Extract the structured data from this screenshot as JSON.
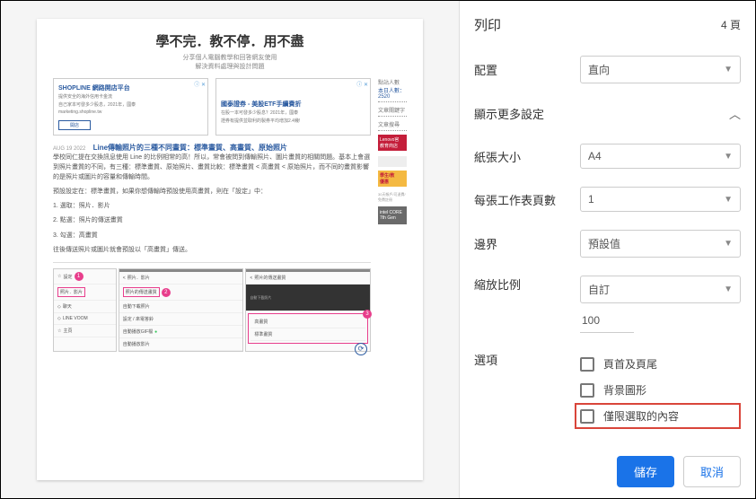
{
  "print": {
    "title": "列印",
    "pages": "4 頁",
    "layout_label": "配置",
    "layout_value": "直向",
    "more_settings": "顯示更多設定",
    "paper_label": "紙張大小",
    "paper_value": "A4",
    "sheets_label": "每張工作表頁數",
    "sheets_value": "1",
    "margin_label": "邊界",
    "margin_value": "預設值",
    "scale_label": "縮放比例",
    "scale_value": "自訂",
    "scale_number": "100",
    "options_label": "選項",
    "opt_header_footer": "頁首及頁尾",
    "opt_backgrounds": "背景圖形",
    "opt_selection": "僅限選取的內容",
    "save": "儲存",
    "cancel": "取消"
  },
  "preview": {
    "title": "學不完．教不停．用不盡",
    "subtitle1": "分享個人電腦教學和回答網友使用",
    "subtitle2": "解決資料處理與設計問題",
    "ad1_title": "SHOPLINE 網路開店平台",
    "ad1_line1": "提供安全的海外信用卡金流",
    "ad1_line2": "自己家本可發多少股息，2021年，國泰",
    "ad1_btn": "開店",
    "ad2_title": "國泰證券 - 美股ETF手續費折",
    "ad2_line": "在股一本可發多少股息？2021年，國泰",
    "ad2_line2": "證券有提供並取利的製券平均增加2.4幾!",
    "sb_visitors": "點站人數",
    "sb_today": "本日人數：2520",
    "sb_articles": "文章關鍵字",
    "sb_search": "文章搜尋",
    "date": "AUG 19 2022",
    "article_title": "Line傳輸照片的三種不同畫質：標準畫質、高畫質、原始照片",
    "p1": "學校同仁提在交換訊息使用 Line 的比例相常的高！所以，常會被問到傳輸照片、圖片畫質的相關問題。基本上會選到照片畫質的不同，有三種：標準畫質、原始照片、畫質比較：標準畫質 < 高畫質 < 原始照片，而不同的畫質影響的是照片或圖片的容量和傳輸時間。",
    "p2": "預設設定在：標準畫質，如果你想傳輸時預設使用高畫質，則在「設定」中：",
    "step1": "1. 選取：照片．影片",
    "step2": "2. 點選：照片的傳送畫質",
    "step3": "3. 勾選：高畫質",
    "p3": "往後傳送照片或圖片就會預設以「高畫質」傳送。",
    "sc_item1": "照片．影片",
    "sc_item2": "照片的傳送畫質",
    "sc_item3": "自動下載照片",
    "sc_item4": "自動播放GIF檔",
    "sc_item5": "自動播放影片",
    "sc_item6": "設定",
    "sc_item7": "照片．影片",
    "sc_item8": "聊天",
    "sc_item9": "LINE VOOM",
    "sc_item10": "主頁",
    "sc_hq": "高畫質",
    "sc_std": "標準畫質",
    "sc_kb": "設定 / 來電答鈴",
    "right_ad1a": "Lenovo官",
    "right_ad1b": "教育商店",
    "right_ad2a": "學生/教",
    "right_ad2b": "優惠"
  }
}
